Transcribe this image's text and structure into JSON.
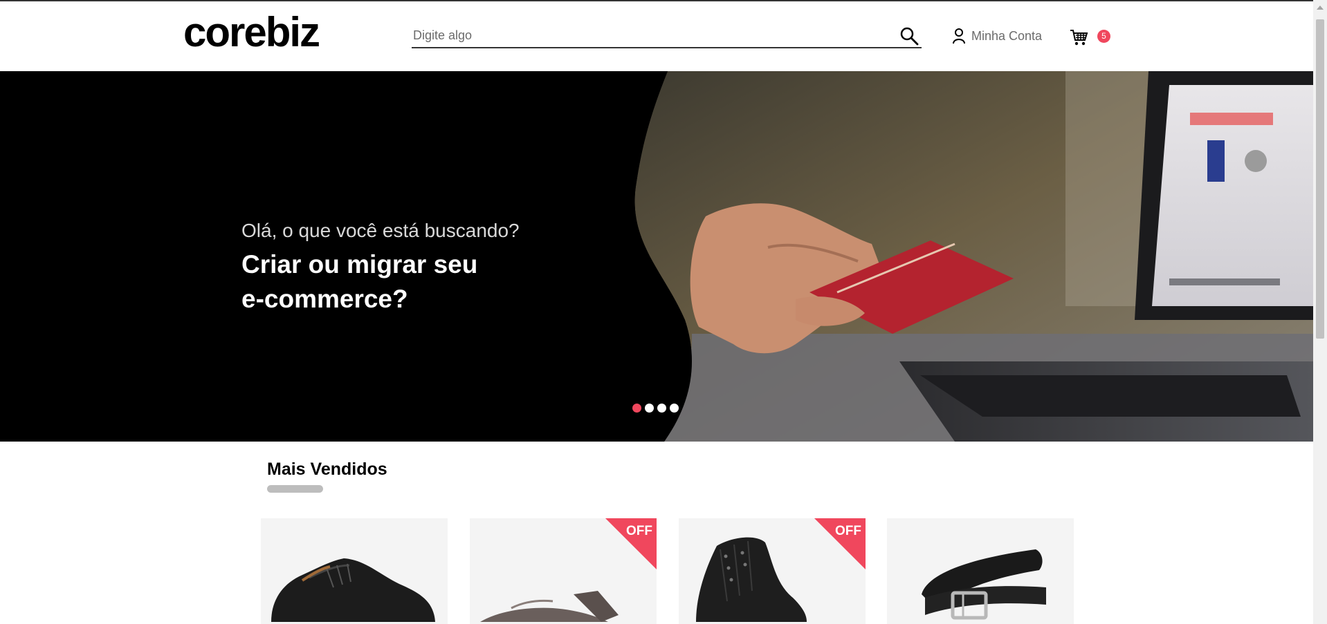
{
  "brand": {
    "logo_text": "corebiz"
  },
  "header": {
    "search": {
      "placeholder": "Digite algo",
      "value": ""
    },
    "account_label": "Minha Conta",
    "cart_count": "5"
  },
  "hero": {
    "subtitle": "Olá, o que você está buscando?",
    "title_line1": "Criar ou migrar seu",
    "title_line2": "e-commerce?",
    "slides": 4,
    "active_slide": 1
  },
  "best_sellers": {
    "title": "Mais Vendidos",
    "products": [
      {
        "image": "black-shoe",
        "off": false
      },
      {
        "image": "brown-sandal",
        "off": true,
        "badge": "OFF"
      },
      {
        "image": "black-boot",
        "off": true,
        "badge": "OFF"
      },
      {
        "image": "black-belt",
        "off": false
      }
    ]
  },
  "colors": {
    "accent": "#f0475d",
    "hero_bg": "#000000"
  }
}
